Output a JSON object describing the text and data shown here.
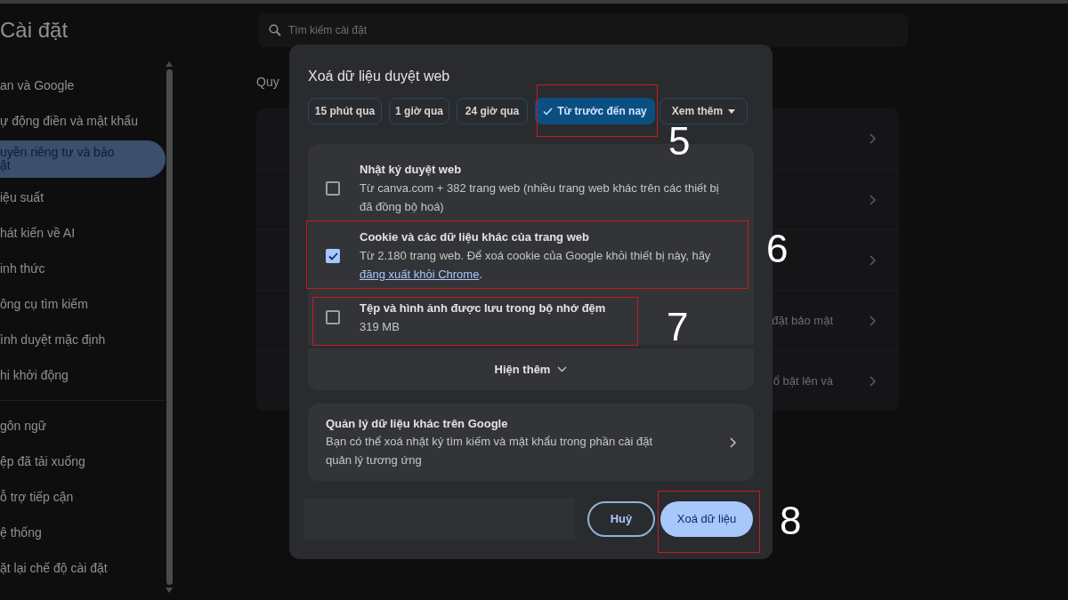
{
  "header": {
    "title": "Cài đặt",
    "search": {
      "placeholder": "Tìm kiếm cài đặt"
    }
  },
  "sidebar": {
    "items": [
      {
        "lines": [
          "an và Google"
        ],
        "selected": false
      },
      {
        "lines": [
          "ự động điền và mật khẩu"
        ],
        "selected": false
      },
      {
        "lines": [
          "uyền riêng tư và bảo",
          "ật"
        ],
        "selected": true
      },
      {
        "lines": [
          "iệu suất"
        ],
        "selected": false
      },
      {
        "lines": [
          "hát kiến về AI"
        ],
        "selected": false
      },
      {
        "lines": [
          "inh thức"
        ],
        "selected": false
      },
      {
        "lines": [
          "ông cụ tìm kiếm"
        ],
        "selected": false
      },
      {
        "lines": [
          "ình duyệt mặc định"
        ],
        "selected": false
      },
      {
        "lines": [
          "hi khởi động"
        ],
        "selected": false,
        "divider_after": true
      },
      {
        "lines": [
          "gôn ngữ"
        ],
        "selected": false
      },
      {
        "lines": [
          "ệp đã tải xuống"
        ],
        "selected": false
      },
      {
        "lines": [
          "ỗ trợ tiếp cận"
        ],
        "selected": false
      },
      {
        "lines": [
          "ệ thống"
        ],
        "selected": false
      },
      {
        "lines": [
          "ặt lại chế độ cài đặt"
        ],
        "selected": false
      }
    ]
  },
  "main": {
    "heading": "Quy",
    "rows": [
      {
        "kind": "row"
      },
      {
        "kind": "row"
      },
      {
        "kind": "row"
      },
      {
        "text": "đặt bảo mật"
      },
      {
        "text": "ổ bật lên và"
      }
    ]
  },
  "dialog": {
    "title": "Xoá dữ liệu duyệt web",
    "ranges": [
      {
        "label": "15 phút qua",
        "selected": false
      },
      {
        "label": "1 giờ qua",
        "selected": false
      },
      {
        "label": "24 giờ qua",
        "selected": false
      },
      {
        "label": "Từ trước đến nay",
        "selected": true
      },
      {
        "label": "Xem thêm",
        "kind": "dropdown",
        "selected": false
      }
    ],
    "options": [
      {
        "title": "Nhật ký duyệt web",
        "detail": "Từ canva.com + 382 trang web (nhiều trang web khác trên các thiết bị đã đồng bộ hoá)",
        "checked": false
      },
      {
        "title": "Cookie và các dữ liệu khác của trang web",
        "detail": "Từ 2.180 trang web. Để xoá cookie của Google khỏi thiết bị này, hãy",
        "link": "đăng xuất khỏi Chrome",
        "link_after": ".",
        "checked": true
      },
      {
        "title": "Tệp và hình ảnh được lưu trong bộ nhớ đệm",
        "detail": "319 MB",
        "checked": false
      }
    ],
    "show_more": "Hiện thêm",
    "google": {
      "title": "Quản lý dữ liệu khác trên Google",
      "detail": "Bạn có thể xoá nhật ký tìm kiếm và mật khẩu trong phần cài đặt quản lý tương ứng"
    },
    "cancel": "Huỷ",
    "confirm": "Xoá dữ liệu"
  },
  "annotations": [
    "5",
    "6",
    "7",
    "8"
  ]
}
